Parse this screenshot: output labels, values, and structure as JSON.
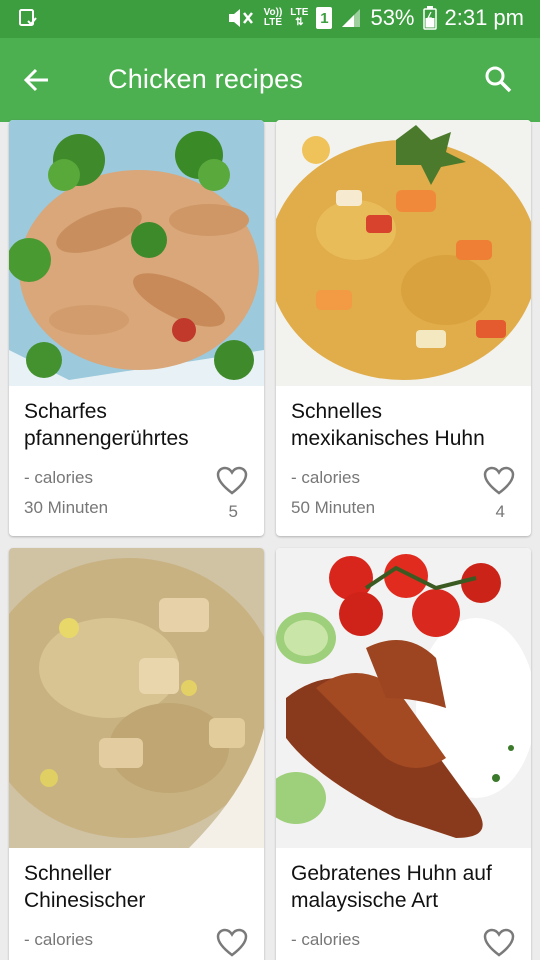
{
  "status_bar": {
    "volte_top": "Vo))",
    "volte_bottom": "LTE",
    "lte_label": "LTE",
    "sim_label": "1",
    "battery": "53%",
    "time": "2:31 pm"
  },
  "app_bar": {
    "title": "Chicken recipes"
  },
  "recipes": [
    {
      "name_line1": "Scharfes",
      "name_line2": "pfannengerührtes",
      "calories": "- calories",
      "time": "30 Minuten",
      "likes": "5"
    },
    {
      "name_line1": "Schnelles",
      "name_line2": "mexikanisches Huhn",
      "calories": "- calories",
      "time": "50 Minuten",
      "likes": "4"
    },
    {
      "name_line1": "Schneller",
      "name_line2": "Chinesischer",
      "calories": "- calories"
    },
    {
      "name_line1": "Gebratenes Huhn auf",
      "name_line2": "malaysische Art",
      "calories": "- calories"
    }
  ]
}
